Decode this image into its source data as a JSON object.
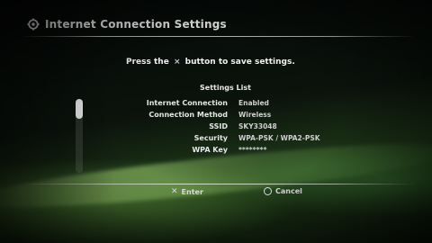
{
  "header": {
    "title": "Internet Connection Settings",
    "icon": "settings-gear-icon"
  },
  "prompt": {
    "before": "Press the",
    "glyph": "×",
    "after": "button to save settings."
  },
  "settings_list": {
    "title": "Settings List",
    "rows": [
      {
        "label": "Internet Connection",
        "value": "Enabled"
      },
      {
        "label": "Connection Method",
        "value": "Wireless"
      },
      {
        "label": "SSID",
        "value": "SKY33048"
      },
      {
        "label": "Security",
        "value": "WPA-PSK / WPA2-PSK"
      },
      {
        "label": "WPA Key",
        "value": "********"
      }
    ]
  },
  "footer": {
    "enter_glyph": "✕",
    "enter_label": "Enter",
    "cancel_label": "Cancel"
  },
  "colors": {
    "background": "#000000",
    "accent_green": "#8fc86a",
    "text": "#f0f0f0"
  }
}
